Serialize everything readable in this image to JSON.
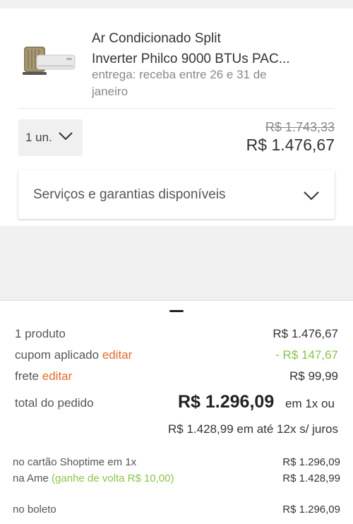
{
  "product": {
    "title_line1": "Ar Condicionado Split",
    "title_line2": "Inverter Philco 9000 BTUs PAC...",
    "delivery_line1": "entrega: receba entre 26 e 31 de",
    "delivery_line2": "janeiro",
    "quantity": "1 un.",
    "old_price": "R$ 1.743,33",
    "price": "R$ 1.476,67"
  },
  "services": {
    "label": "Serviços e garantias disponíveis"
  },
  "summary": {
    "products_label": "1 produto",
    "products_value": "R$ 1.476,67",
    "coupon_label": "cupom aplicado",
    "coupon_edit": "editar",
    "coupon_value": "- R$ 147,67",
    "shipping_label": "frete",
    "shipping_edit": "editar",
    "shipping_value": "R$ 99,99",
    "total_label": "total do pedido",
    "total_value": "R$ 1.296,09",
    "total_suffix": "em 1x ou",
    "installments": "R$ 1.428,99 em até 12x s/ juros"
  },
  "payments": {
    "card_label": "no cartão Shoptime em 1x",
    "card_value": "R$ 1.296,09",
    "ame_label": "na Ame",
    "ame_cashback": "(ganhe de volta R$ 10,00)",
    "ame_value": "R$ 1.428,99",
    "boleto_label": "no boleto",
    "boleto_value": "R$ 1.296,09"
  },
  "colors": {
    "accent_orange": "#e26a2c",
    "accent_green": "#8bc34a"
  },
  "icons": {
    "quantity_dropdown": "chevron-down-icon",
    "services_dropdown": "chevron-down-icon",
    "product_image": "air-conditioner-image"
  }
}
